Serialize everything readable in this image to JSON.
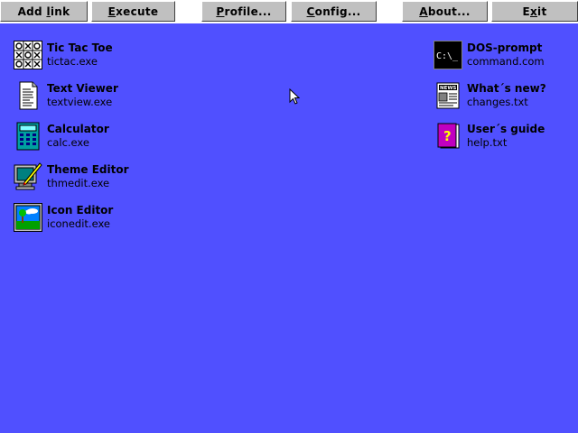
{
  "toolbar": {
    "buttons": [
      {
        "pre": "Add ",
        "ul": "l",
        "post": "ink"
      },
      {
        "pre": "",
        "ul": "E",
        "post": "xecute"
      },
      {
        "pre": "",
        "ul": "P",
        "post": "rofile..."
      },
      {
        "pre": "",
        "ul": "C",
        "post": "onfig..."
      },
      {
        "pre": "",
        "ul": "A",
        "post": "bout..."
      },
      {
        "pre": "E",
        "ul": "x",
        "post": "it"
      }
    ]
  },
  "desktop": {
    "left_items": [
      {
        "title": "Tic Tac Toe",
        "file": "tictac.exe",
        "icon": "tictactoe-icon"
      },
      {
        "title": "Text Viewer",
        "file": "textview.exe",
        "icon": "text-document-icon"
      },
      {
        "title": "Calculator",
        "file": "calc.exe",
        "icon": "calculator-icon"
      },
      {
        "title": "Theme Editor",
        "file": "thmedit.exe",
        "icon": "theme-editor-icon"
      },
      {
        "title": "Icon Editor",
        "file": "iconedit.exe",
        "icon": "icon-editor-icon"
      }
    ],
    "right_items": [
      {
        "title": "DOS-prompt",
        "file": "command.com",
        "icon": "dos-prompt-icon",
        "icon_text": "C:\\_"
      },
      {
        "title": "What´s new?",
        "file": "changes.txt",
        "icon": "news-icon",
        "icon_text": "NEWS"
      },
      {
        "title": "User´s guide",
        "file": "help.txt",
        "icon": "help-book-icon",
        "icon_text": "?"
      }
    ]
  },
  "colors": {
    "desktop_background": "#5050ff",
    "toolbar_background": "#ffffff",
    "button_face": "#c0c0c0"
  }
}
